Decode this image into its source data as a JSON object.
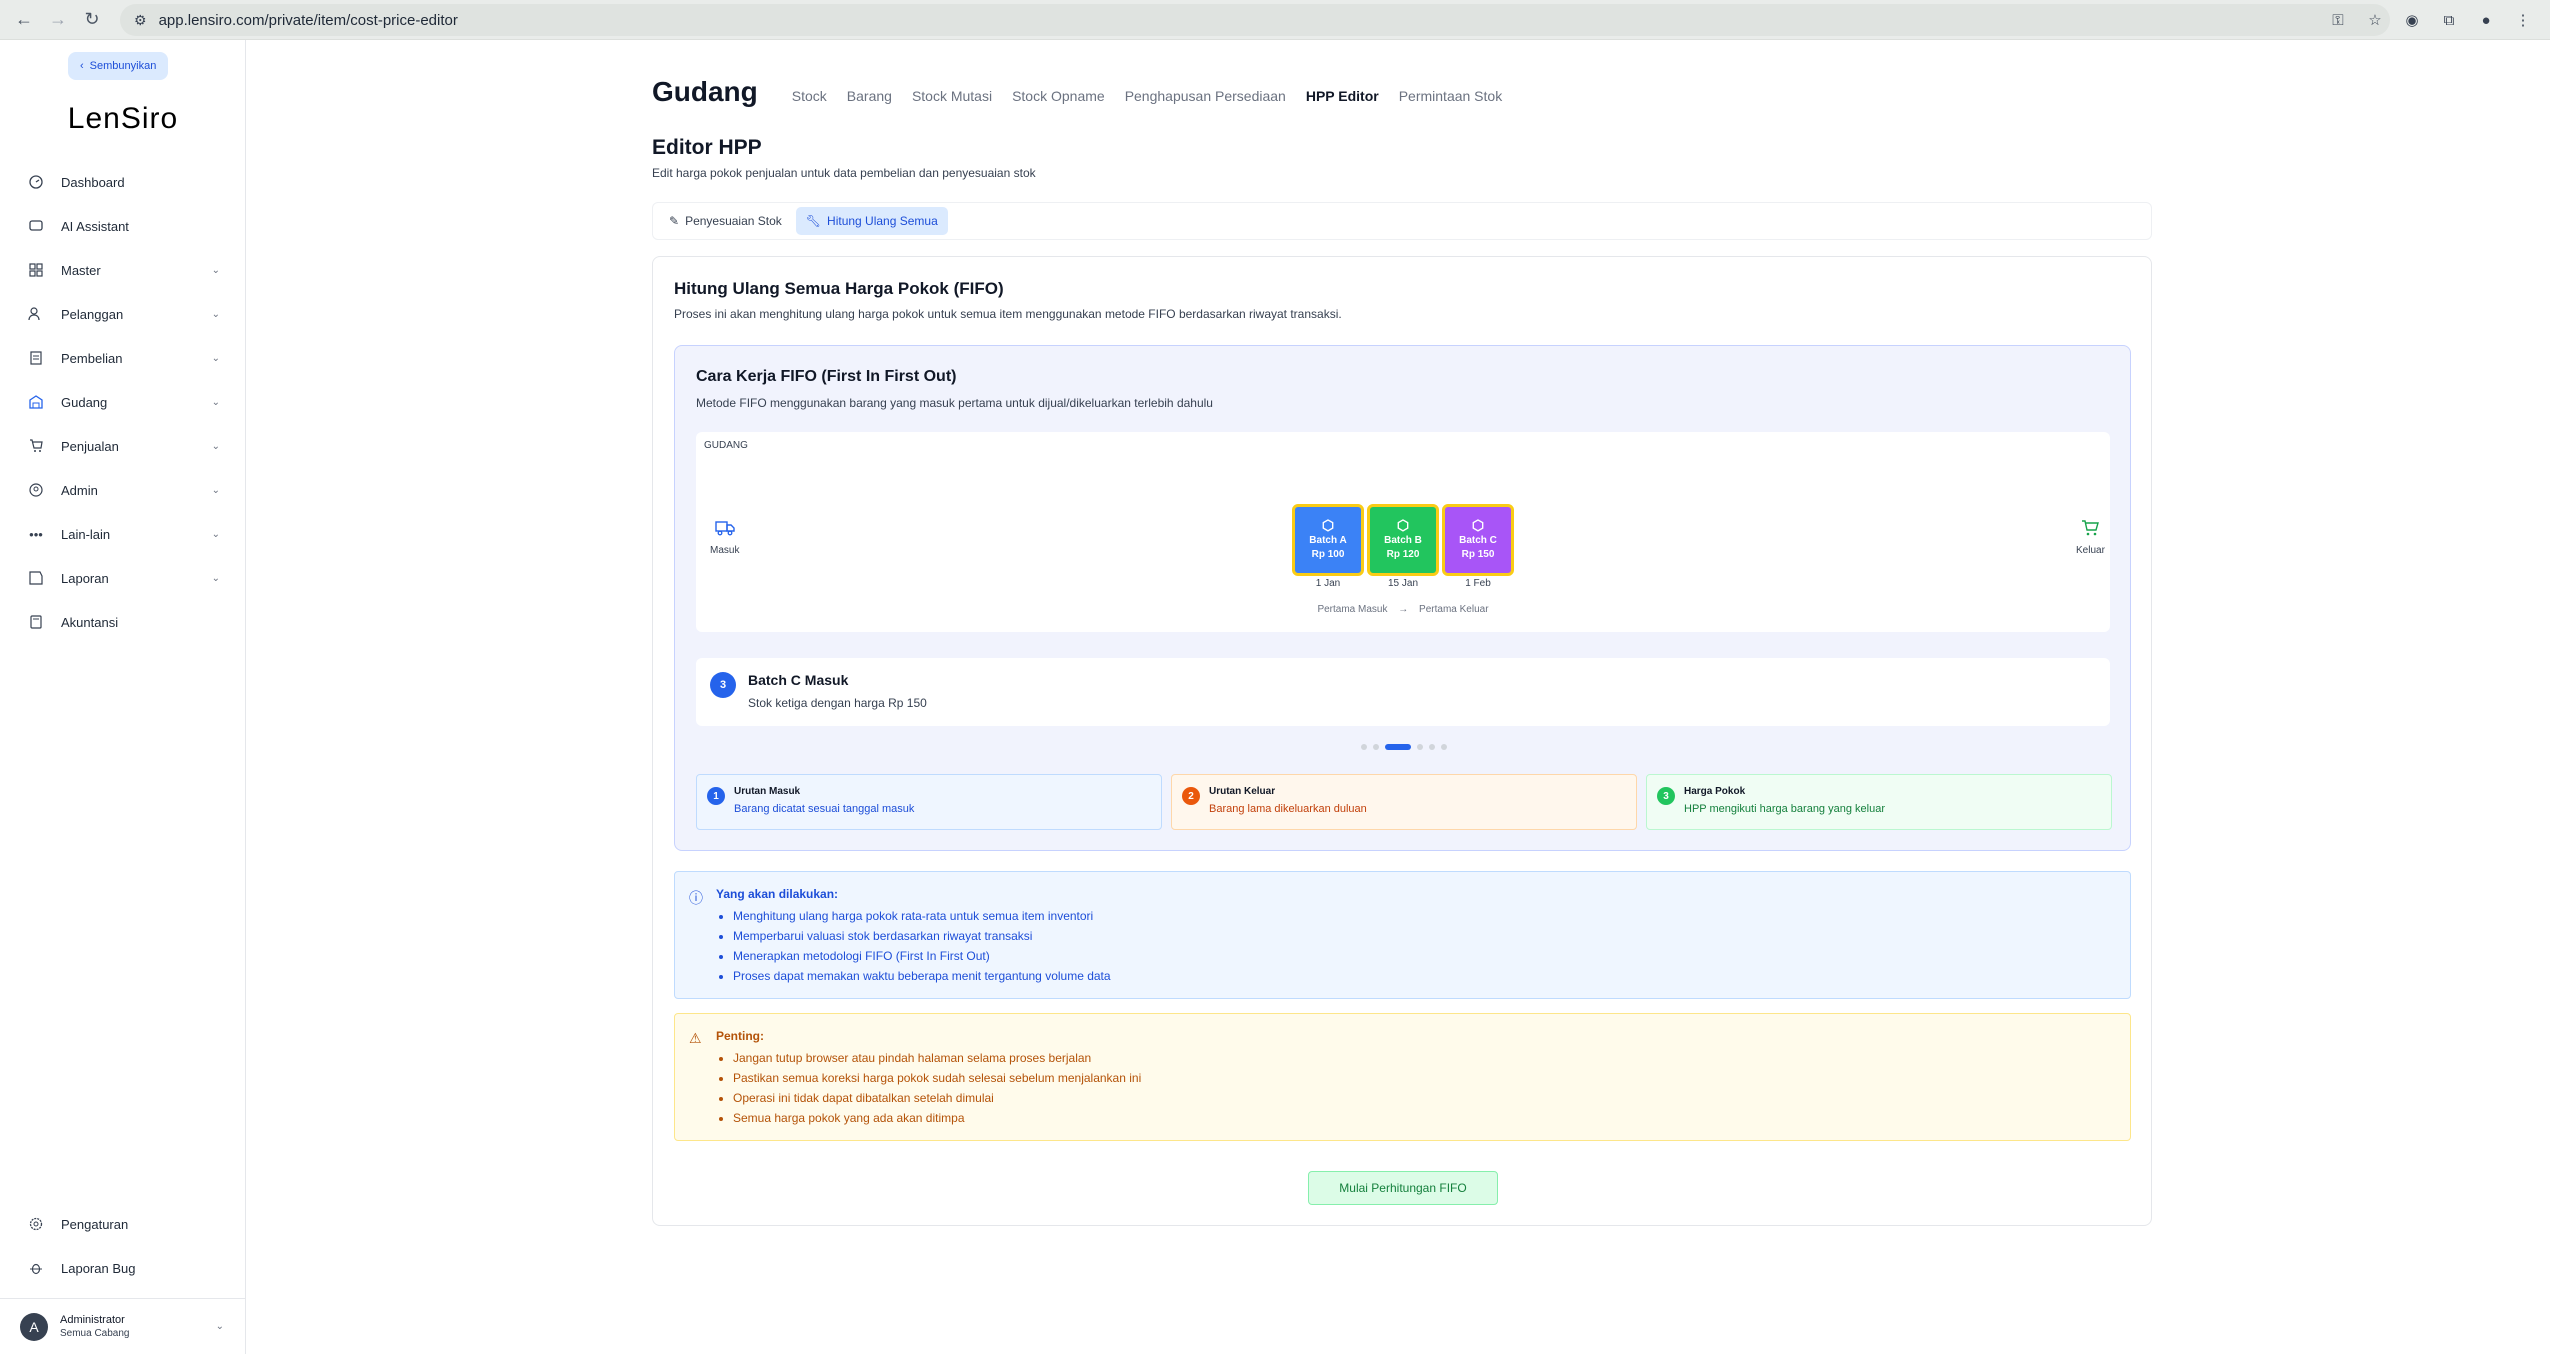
{
  "browser": {
    "url": "app.lensiro.com/private/item/cost-price-editor"
  },
  "sidebar": {
    "hide_label": "Sembunyikan",
    "logo": "LenSiro",
    "items": [
      {
        "label": "Dashboard",
        "icon": "dashboard-icon"
      },
      {
        "label": "AI Assistant",
        "icon": "chat-icon"
      },
      {
        "label": "Master",
        "icon": "grid-icon"
      },
      {
        "label": "Pelanggan",
        "icon": "users-icon"
      },
      {
        "label": "Pembelian",
        "icon": "receipt-icon"
      },
      {
        "label": "Gudang",
        "icon": "warehouse-icon"
      },
      {
        "label": "Penjualan",
        "icon": "cart-icon"
      },
      {
        "label": "Admin",
        "icon": "user-circle-icon"
      },
      {
        "label": "Lain-lain",
        "icon": "more-icon"
      },
      {
        "label": "Laporan",
        "icon": "clipboard-icon"
      },
      {
        "label": "Akuntansi",
        "icon": "calculator-icon"
      }
    ],
    "bottom_items": [
      {
        "label": "Pengaturan",
        "icon": "gear-icon"
      },
      {
        "label": "Laporan Bug",
        "icon": "bug-icon"
      }
    ],
    "user": {
      "initial": "A",
      "name": "Administrator",
      "branch": "Semua Cabang"
    }
  },
  "header": {
    "title": "Gudang",
    "nav": [
      "Stock",
      "Barang",
      "Stock Mutasi",
      "Stock Opname",
      "Penghapusan Persediaan",
      "HPP Editor",
      "Permintaan Stok"
    ],
    "active_nav": "HPP Editor"
  },
  "page": {
    "title": "Editor HPP",
    "subtitle": "Edit harga pokok penjualan untuk data pembelian dan penyesuaian stok",
    "tabs": [
      "Penyesuaian Stok",
      "Hitung Ulang Semua"
    ]
  },
  "card": {
    "title": "Hitung Ulang Semua Harga Pokok (FIFO)",
    "desc": "Proses ini akan menghitung ulang harga pokok untuk semua item menggunakan metode FIFO berdasarkan riwayat transaksi."
  },
  "fifo": {
    "title": "Cara Kerja FIFO (First In First Out)",
    "desc": "Metode FIFO menggunakan barang yang masuk pertama untuk dijual/dikeluarkan terlebih dahulu",
    "warehouse_label": "GUDANG",
    "in_label": "Masuk",
    "out_label": "Keluar",
    "batches": [
      {
        "name": "Batch A",
        "price": "Rp 100",
        "date": "1 Jan",
        "color": "#3b82f6"
      },
      {
        "name": "Batch B",
        "price": "Rp 120",
        "date": "15 Jan",
        "color": "#22c55e"
      },
      {
        "name": "Batch C",
        "price": "Rp 150",
        "date": "1 Feb",
        "color": "#a855f7"
      }
    ],
    "flow_first_in": "Pertama Masuk",
    "flow_arrow": "→",
    "flow_first_out": "Pertama Keluar",
    "step": {
      "number": "3",
      "title": "Batch C Masuk",
      "desc": "Stok ketiga dengan harga Rp 150"
    },
    "steps_total": 7,
    "steps_active": 3,
    "legend": [
      {
        "num": "1",
        "title": "Urutan Masuk",
        "desc": "Barang dicatat sesuai tanggal masuk"
      },
      {
        "num": "2",
        "title": "Urutan Keluar",
        "desc": "Barang lama dikeluarkan duluan"
      },
      {
        "num": "3",
        "title": "Harga Pokok",
        "desc": "HPP mengikuti harga barang yang keluar"
      }
    ]
  },
  "info": {
    "title": "Yang akan dilakukan:",
    "items": [
      "Menghitung ulang harga pokok rata-rata untuk semua item inventori",
      "Memperbarui valuasi stok berdasarkan riwayat transaksi",
      "Menerapkan metodologi FIFO (First In First Out)",
      "Proses dapat memakan waktu beberapa menit tergantung volume data"
    ]
  },
  "warning": {
    "title": "Penting:",
    "items": [
      "Jangan tutup browser atau pindah halaman selama proses berjalan",
      "Pastikan semua koreksi harga pokok sudah selesai sebelum menjalankan ini",
      "Operasi ini tidak dapat dibatalkan setelah dimulai",
      "Semua harga pokok yang ada akan ditimpa"
    ]
  },
  "start_button": "Mulai Perhitungan FIFO"
}
